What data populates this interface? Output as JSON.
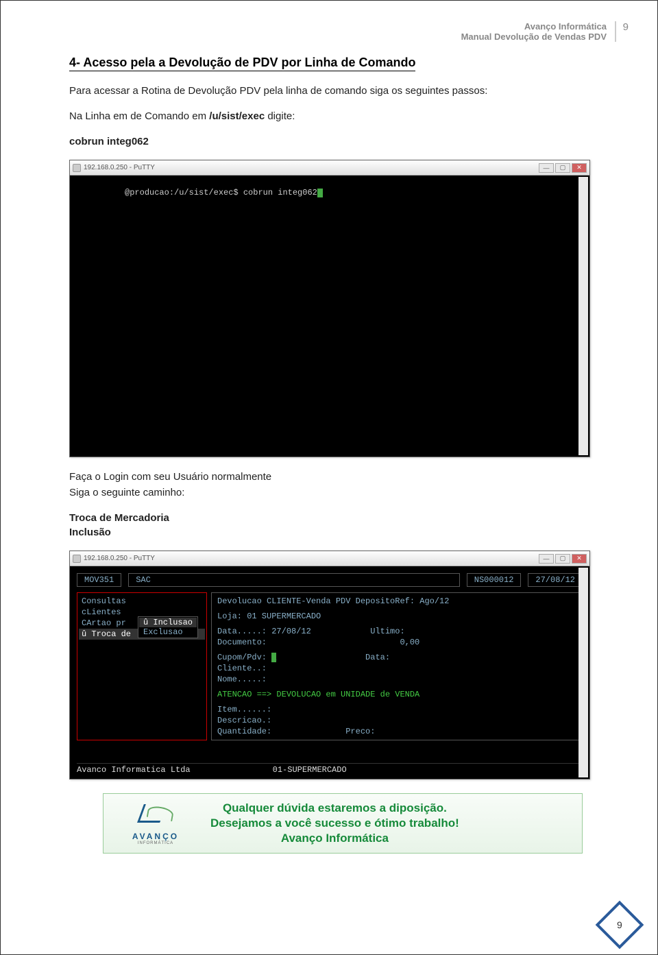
{
  "header": {
    "brand": "Avanço Informática",
    "manual": "Manual Devolução de Vendas PDV",
    "page_number": "9"
  },
  "section": {
    "title": "4-  Acesso pela a Devolução de PDV por Linha de Comando",
    "p1": "Para acessar a Rotina de Devolução PDV pela linha de comando siga os seguintes passos:",
    "p2_prefix": "Na Linha em de Comando em ",
    "p2_path": "/u/sist/exec",
    "p2_suffix": " digite:",
    "p3": "cobrun integ062"
  },
  "putty1": {
    "title": "192.168.0.250 - PuTTY",
    "prompt": "@producao:/u/sist/exec$ cobrun integ062"
  },
  "mid": {
    "p4": "Faça o Login com seu Usuário normalmente",
    "p5": "Siga o seguinte caminho:",
    "p6": "Troca de Mercadoria",
    "p7": "Inclusão"
  },
  "putty2": {
    "title": "192.168.0.250 - PuTTY",
    "top": {
      "code": "MOV351",
      "sac": "SAC",
      "ns": "NS000012",
      "date": "27/08/12"
    },
    "left_menu": [
      "Consultas",
      "cLientes",
      "CArtao pr",
      "û Troca de"
    ],
    "submenu": [
      "û Inclusao",
      "  Exclusao"
    ],
    "right": {
      "r1": "Devolucao CLIENTE-Venda PDV DepositoRef: Ago/12",
      "r2": "Loja: 01 SUPERMERCADO",
      "r3": "Data.....: 27/08/12            Ultimo:",
      "r4": "Documento:                           0,00",
      "r5": "Cupom/Pdv:                   Data:",
      "r6": "Cliente..:",
      "r7": "Nome.....:",
      "r8": "ATENCAO ==> DEVOLUCAO em UNIDADE de VENDA",
      "r9": "Item......:",
      "r10": "Descricao.:",
      "r11": "Quantidade:               Preco:"
    },
    "footer_left": "Avanco Informatica Ltda",
    "footer_right": "01-SUPERMERCADO"
  },
  "infobox": {
    "logo_name": "AVANÇO",
    "logo_sub": "INFORMÁTICA",
    "line1": "Qualquer dúvida estaremos a diposição.",
    "line2": "Desejamos a você sucesso e ótimo trabalho!",
    "line3": "Avanço Informática"
  },
  "footer_page": "9"
}
